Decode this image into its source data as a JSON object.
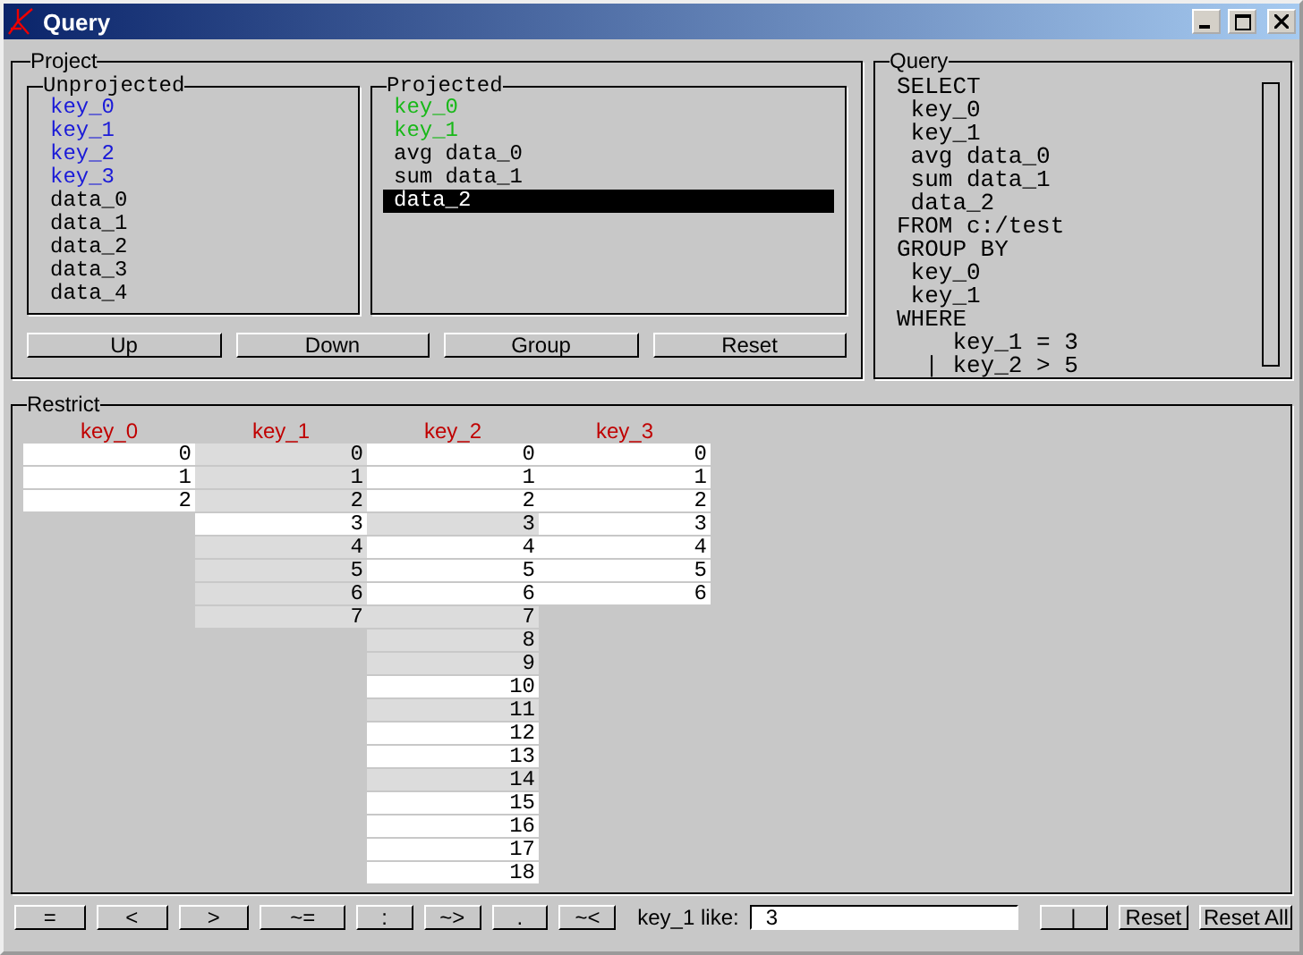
{
  "window": {
    "title": "Query"
  },
  "project": {
    "title": "Project",
    "unprojected": {
      "title": "Unprojected",
      "items": [
        {
          "label": "key_0",
          "kind": "key"
        },
        {
          "label": "key_1",
          "kind": "key"
        },
        {
          "label": "key_2",
          "kind": "key"
        },
        {
          "label": "key_3",
          "kind": "key"
        },
        {
          "label": "data_0",
          "kind": "data"
        },
        {
          "label": "data_1",
          "kind": "data"
        },
        {
          "label": "data_2",
          "kind": "data"
        },
        {
          "label": "data_3",
          "kind": "data"
        },
        {
          "label": "data_4",
          "kind": "data"
        }
      ]
    },
    "projected": {
      "title": "Projected",
      "items": [
        {
          "label": "key_0",
          "kind": "group",
          "selected": false
        },
        {
          "label": "key_1",
          "kind": "group",
          "selected": false
        },
        {
          "label": "avg data_0",
          "kind": "data",
          "selected": false
        },
        {
          "label": "sum data_1",
          "kind": "data",
          "selected": false
        },
        {
          "label": "data_2",
          "selected": true
        }
      ]
    },
    "buttons": [
      "Up",
      "Down",
      "Group",
      "Reset"
    ]
  },
  "query": {
    "title": "Query",
    "lines": [
      "SELECT",
      " key_0",
      " key_1",
      " avg data_0",
      " sum data_1",
      " data_2",
      "FROM c:/test",
      "GROUP BY",
      " key_0",
      " key_1",
      "WHERE",
      "    key_1 = 3",
      "  | key_2 > 5"
    ]
  },
  "restrict": {
    "title": "Restrict",
    "columns": [
      {
        "name": "key_0",
        "values": [
          {
            "v": "0",
            "selected": true
          },
          {
            "v": "1",
            "selected": true
          },
          {
            "v": "2",
            "selected": true
          }
        ]
      },
      {
        "name": "key_1",
        "values": [
          {
            "v": "0",
            "selected": false
          },
          {
            "v": "1",
            "selected": false
          },
          {
            "v": "2",
            "selected": false
          },
          {
            "v": "3",
            "selected": true
          },
          {
            "v": "4",
            "selected": false
          },
          {
            "v": "5",
            "selected": false
          },
          {
            "v": "6",
            "selected": false
          },
          {
            "v": "7",
            "selected": false
          }
        ]
      },
      {
        "name": "key_2",
        "values": [
          {
            "v": "0",
            "selected": true
          },
          {
            "v": "1",
            "selected": true
          },
          {
            "v": "2",
            "selected": true
          },
          {
            "v": "3",
            "selected": false
          },
          {
            "v": "4",
            "selected": true
          },
          {
            "v": "5",
            "selected": true
          },
          {
            "v": "6",
            "selected": true
          },
          {
            "v": "7",
            "selected": false
          },
          {
            "v": "8",
            "selected": false
          },
          {
            "v": "9",
            "selected": false
          },
          {
            "v": "10",
            "selected": true
          },
          {
            "v": "11",
            "selected": false
          },
          {
            "v": "12",
            "selected": true
          },
          {
            "v": "13",
            "selected": true
          },
          {
            "v": "14",
            "selected": false
          },
          {
            "v": "15",
            "selected": true
          },
          {
            "v": "16",
            "selected": true
          },
          {
            "v": "17",
            "selected": true
          },
          {
            "v": "18",
            "selected": true
          }
        ]
      },
      {
        "name": "key_3",
        "values": [
          {
            "v": "0",
            "selected": true
          },
          {
            "v": "1",
            "selected": true
          },
          {
            "v": "2",
            "selected": true
          },
          {
            "v": "3",
            "selected": true
          },
          {
            "v": "4",
            "selected": true
          },
          {
            "v": "5",
            "selected": true
          },
          {
            "v": "6",
            "selected": true
          }
        ]
      }
    ]
  },
  "bottom_bar": {
    "operators": [
      {
        "label": "=",
        "kind": "wide"
      },
      {
        "label": "<",
        "kind": "wide"
      },
      {
        "label": ">",
        "kind": "wide"
      },
      {
        "label": "~=",
        "kind": "wide"
      },
      {
        "label": ":",
        "kind": "narrow"
      },
      {
        "label": "~>",
        "kind": "narrow"
      },
      {
        "label": ".",
        "kind": "narrow"
      },
      {
        "label": "~<",
        "kind": "narrow"
      }
    ],
    "field_label": "key_1 like:",
    "field_value": "3",
    "pipe_button": "|",
    "buttons": [
      "Reset",
      "Reset All"
    ]
  }
}
